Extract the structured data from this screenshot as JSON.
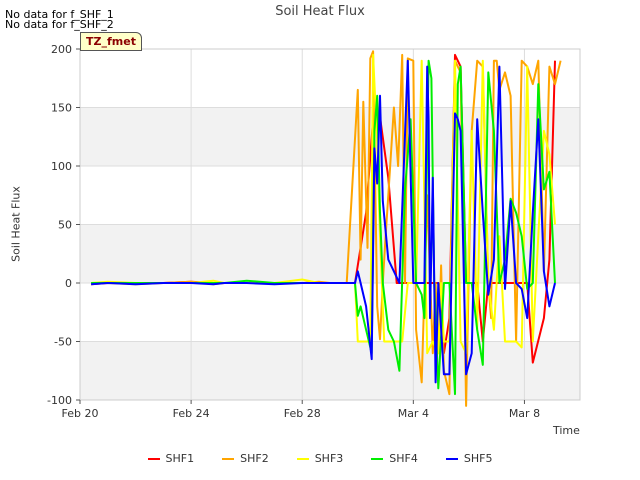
{
  "notes": [
    "No data for f_SHF_1",
    "No data for f_SHF_2"
  ],
  "tz_label": "TZ_fmet",
  "chart_data": {
    "type": "line",
    "title": "Soil Heat Flux",
    "xlabel": "Time",
    "ylabel": "Soil Heat Flux",
    "ylim": [
      -100,
      200
    ],
    "yticks": [
      -100,
      -50,
      0,
      50,
      100,
      150,
      200
    ],
    "xlim": [
      0,
      18
    ],
    "xticks": [
      {
        "value": 0,
        "label": "Feb 20"
      },
      {
        "value": 4,
        "label": "Feb 24"
      },
      {
        "value": 8,
        "label": "Feb 28"
      },
      {
        "value": 12,
        "label": "Mar 4"
      },
      {
        "value": 16,
        "label": "Mar 8"
      }
    ],
    "grid": true,
    "band_colors": [
      "#f2f2f2",
      "#ffffff"
    ],
    "legend_position": "bottom",
    "series": [
      {
        "name": "SHF1",
        "color": "#ff0000",
        "x": [
          0.4,
          1,
          2,
          3,
          4,
          4.8,
          5.2,
          6,
          7,
          8,
          8.6,
          9,
          9.6,
          9.9,
          10.3,
          10.6,
          10.8,
          11.1,
          11.4,
          11.6,
          12,
          12.3,
          12.5,
          12.7,
          12.9,
          13.1,
          13.3,
          13.5,
          13.7,
          13.9,
          14.1,
          14.3,
          14.5,
          14.7,
          14.9,
          15.1,
          15.3,
          15.5,
          15.7,
          16.1,
          16.3,
          16.7,
          16.9,
          17.1
        ],
        "y": [
          -1,
          0,
          0,
          0,
          1,
          0,
          0,
          0,
          0,
          0,
          0,
          0,
          0,
          0,
          60,
          155,
          142,
          90,
          0,
          0,
          0,
          0,
          0,
          0,
          0,
          -60,
          -30,
          195,
          185,
          0,
          0,
          0,
          -50,
          0,
          0,
          0,
          0,
          0,
          0,
          0,
          -68,
          -30,
          20,
          190
        ]
      },
      {
        "name": "SHF2",
        "color": "#ffa500",
        "x": [
          0.4,
          1,
          2,
          3,
          4,
          4.8,
          5.2,
          6,
          7,
          8,
          8.6,
          9,
          9.6,
          10.0,
          10.1,
          10.2,
          10.35,
          10.45,
          10.55,
          10.7,
          10.8,
          10.9,
          11.0,
          11.1,
          11.3,
          11.45,
          11.6,
          11.7,
          11.8,
          12.0,
          12.1,
          12.3,
          12.5,
          12.7,
          12.8,
          12.9,
          13.0,
          13.1,
          13.3,
          13.4,
          13.5,
          13.7,
          13.9,
          14.1,
          14.3,
          14.5,
          14.7,
          14.8,
          14.9,
          15.0,
          15.1,
          15.3,
          15.5,
          15.7,
          15.9,
          16.1,
          16.3,
          16.5,
          16.7,
          16.9,
          17.1,
          17.3
        ],
        "y": [
          0,
          0,
          -1,
          0,
          1,
          -1,
          0,
          0,
          0,
          0,
          1,
          0,
          0,
          165,
          20,
          155,
          30,
          192,
          198,
          -20,
          -48,
          0,
          40,
          75,
          150,
          100,
          195,
          0,
          192,
          190,
          -40,
          -85,
          75,
          -60,
          0,
          -60,
          15,
          -75,
          -95,
          75,
          190,
          180,
          -105,
          130,
          190,
          185,
          0,
          -30,
          190,
          190,
          165,
          180,
          160,
          -50,
          190,
          185,
          170,
          190,
          10,
          185,
          170,
          190
        ]
      },
      {
        "name": "SHF3",
        "color": "#ffff00",
        "x": [
          0.4,
          1,
          2,
          3,
          4,
          4.8,
          5.2,
          6,
          7,
          8,
          8.6,
          9,
          9.6,
          9.9,
          10.0,
          10.1,
          10.3,
          10.45,
          10.55,
          10.7,
          10.8,
          10.95,
          11.1,
          11.4,
          11.6,
          11.8,
          12.0,
          12.1,
          12.3,
          12.5,
          12.7,
          12.9,
          13.0,
          13.1,
          13.3,
          13.5,
          13.7,
          13.9,
          14.1,
          14.3,
          14.5,
          14.7,
          14.9,
          15.1,
          15.3,
          15.5,
          15.7,
          15.9,
          16.1,
          16.3,
          16.5,
          16.7,
          16.9,
          17.1
        ],
        "y": [
          0,
          1,
          0,
          0,
          0,
          2,
          0,
          0,
          0,
          3,
          0,
          0,
          0,
          0,
          -50,
          -50,
          -50,
          -50,
          195,
          120,
          40,
          -50,
          -50,
          -50,
          -50,
          0,
          0,
          0,
          190,
          -60,
          -50,
          -60,
          0,
          -50,
          -50,
          190,
          -50,
          -60,
          130,
          -40,
          190,
          0,
          -40,
          40,
          -50,
          -50,
          -50,
          -55,
          185,
          -50,
          40,
          130,
          110,
          50
        ]
      },
      {
        "name": "SHF4",
        "color": "#00ee00",
        "x": [
          0.4,
          1,
          2,
          3,
          4,
          4.8,
          5.2,
          6,
          7,
          8,
          8.6,
          9,
          9.6,
          9.9,
          10.0,
          10.1,
          10.3,
          10.5,
          10.6,
          10.7,
          10.8,
          10.9,
          11.1,
          11.3,
          11.5,
          11.7,
          11.9,
          12.1,
          12.3,
          12.4,
          12.55,
          12.65,
          12.75,
          12.9,
          13.1,
          13.3,
          13.5,
          13.6,
          13.7,
          13.9,
          14.1,
          14.3,
          14.5,
          14.7,
          14.9,
          15.1,
          15.3,
          15.5,
          15.7,
          15.9,
          16.1,
          16.3,
          16.5,
          16.7,
          16.9,
          17.1
        ],
        "y": [
          0,
          0,
          0,
          0,
          0,
          0,
          0,
          2,
          0,
          0,
          0,
          0,
          0,
          0,
          -28,
          -20,
          -40,
          -60,
          130,
          160,
          60,
          0,
          -40,
          -50,
          -75,
          80,
          140,
          0,
          -10,
          -30,
          190,
          175,
          0,
          -90,
          0,
          0,
          -95,
          170,
          185,
          0,
          0,
          -40,
          -70,
          180,
          130,
          0,
          20,
          72,
          60,
          40,
          -5,
          0,
          170,
          80,
          95,
          0
        ]
      },
      {
        "name": "SHF5",
        "color": "#0000ff",
        "x": [
          0.4,
          1,
          2,
          3,
          4,
          4.8,
          5.2,
          6,
          7,
          8,
          8.6,
          9,
          9.6,
          9.9,
          10.0,
          10.1,
          10.3,
          10.5,
          10.6,
          10.7,
          10.8,
          10.9,
          11.1,
          11.5,
          11.8,
          12.0,
          12.2,
          12.3,
          12.4,
          12.5,
          12.55,
          12.6,
          12.7,
          12.8,
          12.9,
          13.1,
          13.3,
          13.5,
          13.6,
          13.7,
          13.9,
          14.1,
          14.3,
          14.5,
          14.7,
          14.9,
          15.1,
          15.3,
          15.5,
          15.7,
          15.9,
          16.1,
          16.3,
          16.5,
          16.7,
          16.9,
          17.1
        ],
        "y": [
          -1,
          0,
          -1,
          0,
          0,
          -1,
          0,
          0,
          -1,
          0,
          0,
          0,
          0,
          0,
          10,
          0,
          -20,
          -65,
          115,
          85,
          160,
          70,
          20,
          0,
          190,
          0,
          0,
          0,
          0,
          185,
          140,
          -30,
          90,
          -85,
          0,
          -78,
          -78,
          145,
          140,
          130,
          -78,
          -60,
          140,
          60,
          -10,
          20,
          185,
          -5,
          70,
          0,
          -5,
          -30,
          60,
          140,
          10,
          -20,
          0
        ]
      }
    ]
  }
}
